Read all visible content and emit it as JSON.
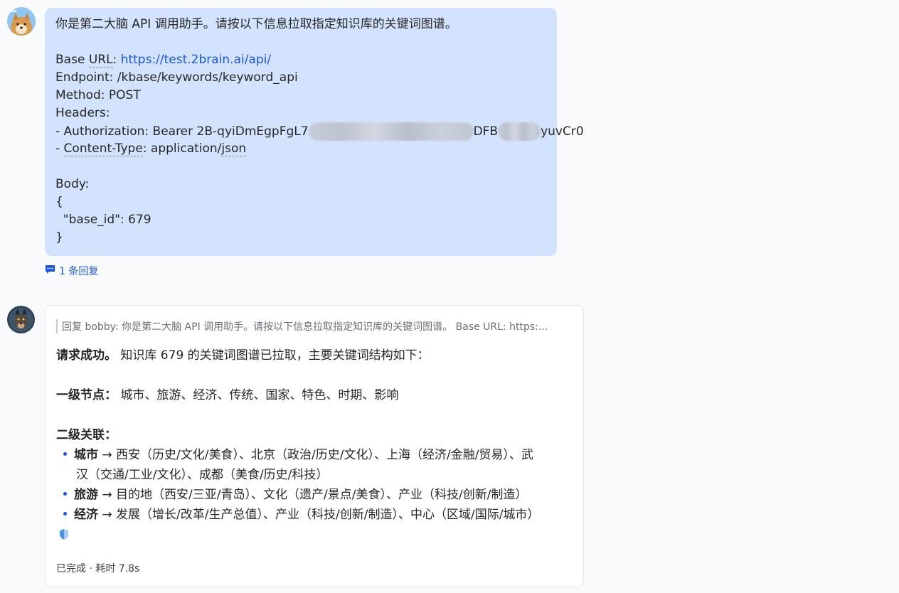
{
  "user_message": {
    "intro": "你是第二大脑 API 调用助手。请按以下信息拉取指定知识库的关键词图谱。",
    "base_url_prefix": "Base ",
    "base_url_key": "URL",
    "base_url_sep": ": ",
    "base_url_value": "https://test.2brain.ai/api/",
    "endpoint": "Endpoint: /kbase/keywords/keyword_api",
    "method": "Method: POST",
    "headers": "Headers:",
    "auth_prefix": "- Authorization: Bearer 2B-qyiDmEgpFgL7",
    "auth_mid": "DFB",
    "auth_suffix": "yuvCr0",
    "content_type_dash": "- ",
    "content_type_key": "Content-Type",
    "content_type_sep": ": application/",
    "content_type_val": "json",
    "body": "Body:",
    "open_brace": "{",
    "base_id_line": "  \"base_id\": 679",
    "close_brace": "}"
  },
  "reply_count": "1 条回复",
  "bot_message": {
    "quote": "回复 bobby:  你是第二大脑 API 调用助手。请按以下信息拉取指定知识库的关键词图谱。 Base URL: https:...",
    "success_bold": "请求成功。",
    "success_text": " 知识库 679 的关键词图谱已拉取，主要关键词结构如下：",
    "level1_bold": "一级节点：",
    "level1_text": " 城市、旅游、经济、传统、国家、特色、时期、影响",
    "level2_bold": "二级关联：",
    "items": [
      {
        "key": "城市",
        "text": " → 西安（历史/文化/美食）、北京（政治/历史/文化）、上海（经济/金融/贸易）、武",
        "cont": "汉（交通/工业/文化）、成都（美食/历史/科技）"
      },
      {
        "key": "旅游",
        "text": " → 目的地（西安/三亚/青岛）、文化（遗产/景点/美食）、产业（科技/创新/制造）"
      },
      {
        "key": "经济",
        "text": " → 发展（增长/改革/生产总值）、产业（科技/创新/制造）、中心（区域/国际/城市）"
      }
    ],
    "status": "已完成 · 耗时 7.8s"
  },
  "colors": {
    "user_bubble": "#d3e3fd",
    "link": "#1a56db",
    "bot_bubble": "#ffffff"
  }
}
